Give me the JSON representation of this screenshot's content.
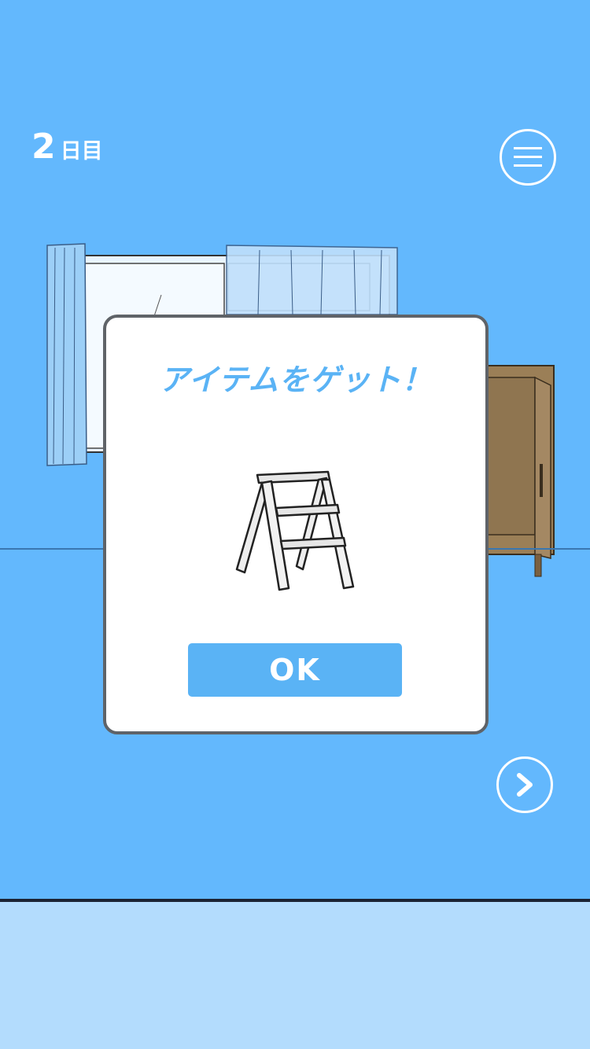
{
  "hud": {
    "day_number": "2",
    "day_suffix": "日目",
    "menu_icon": "hamburger-menu-icon",
    "next_icon": "chevron-right-icon"
  },
  "scene": {
    "objects": [
      "window-with-curtains",
      "wooden-cabinet"
    ]
  },
  "dialog": {
    "title": "アイテムをゲット！",
    "item": "stepladder",
    "ok_label": "OK"
  },
  "colors": {
    "scene_background": "#63b8fd",
    "item_bar": "#b3dcfd",
    "accent": "#5ab3f5",
    "dialog_border": "#5f6368",
    "cabinet": "#9b7f57"
  }
}
